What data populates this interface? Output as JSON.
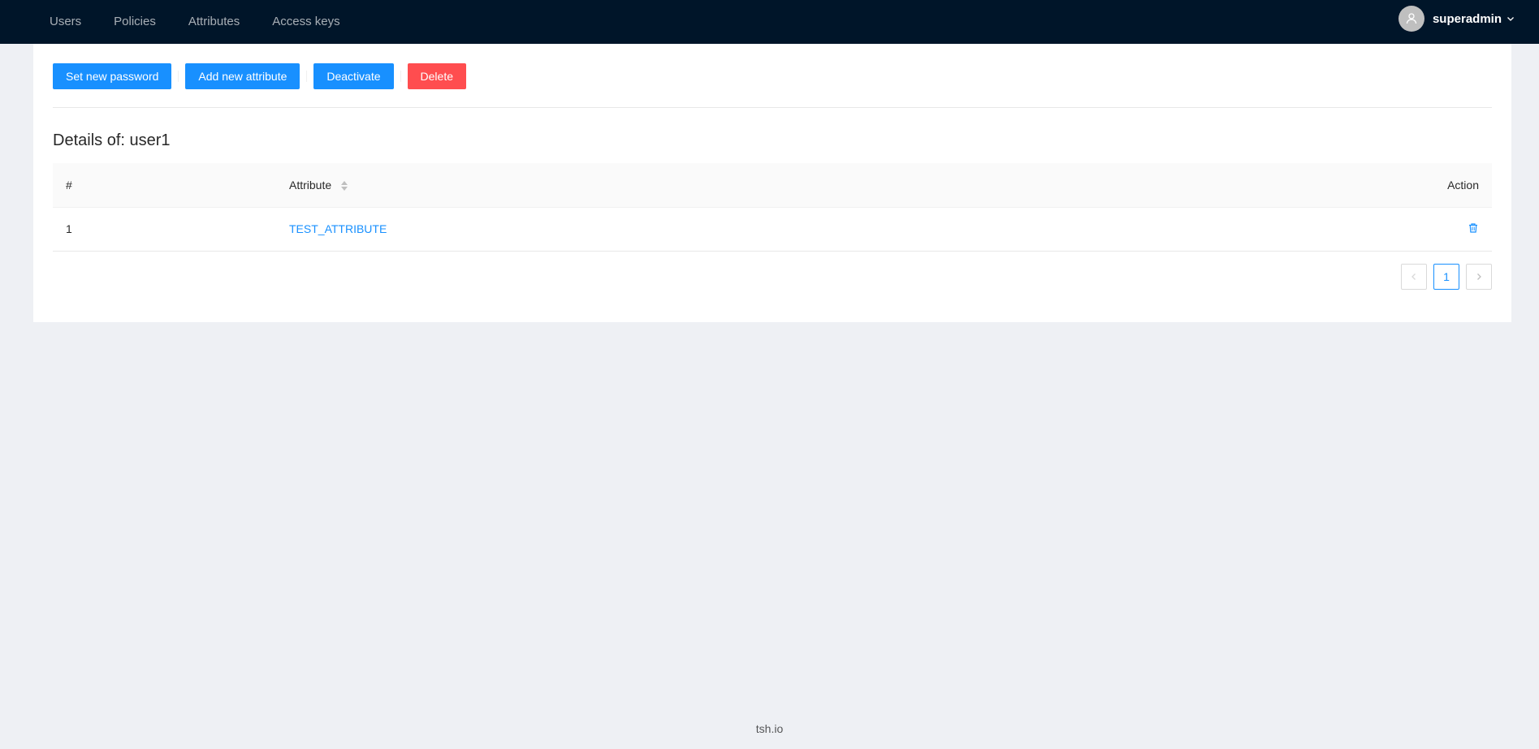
{
  "nav": {
    "items": [
      {
        "label": "Users"
      },
      {
        "label": "Policies"
      },
      {
        "label": "Attributes"
      },
      {
        "label": "Access keys"
      }
    ],
    "user": {
      "name": "superadmin",
      "avatar_icon": "user-icon",
      "dropdown_icon": "chevron-down-icon"
    }
  },
  "toolbar": {
    "set_password_label": "Set new password",
    "add_attribute_label": "Add new attribute",
    "deactivate_label": "Deactivate",
    "delete_label": "Delete"
  },
  "details": {
    "title": "Details of: user1"
  },
  "table": {
    "headers": {
      "num": "#",
      "attribute": "Attribute",
      "action": "Action"
    },
    "rows": [
      {
        "num": "1",
        "attribute": "TEST_ATTRIBUTE",
        "action_icon": "trash-icon"
      }
    ]
  },
  "pagination": {
    "current": "1",
    "prev_icon": "chevron-left-icon",
    "next_icon": "chevron-right-icon"
  },
  "footer": {
    "text": "tsh.io"
  },
  "colors": {
    "header_bg": "#001529",
    "primary": "#1890ff",
    "danger": "#ff4d4f",
    "page_bg": "#eef0f4"
  }
}
